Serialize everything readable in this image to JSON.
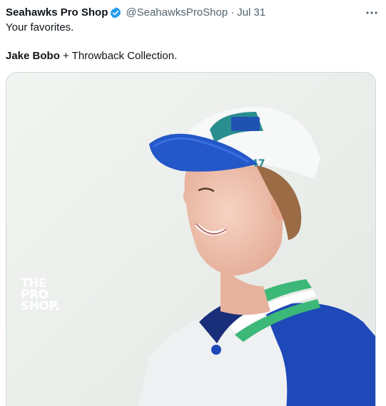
{
  "tweet": {
    "display_name": "Seahawks Pro Shop",
    "handle": "@SeahawksProShop",
    "separator": "·",
    "date": "Jul 31",
    "line1": "Your favorites.",
    "line2_bold": "Jake Bobo",
    "line2_rest": " + Throwback Collection."
  },
  "media": {
    "watermark_lines": [
      "THE",
      "PRO",
      "SHOP."
    ],
    "hat_logo_text": "47"
  },
  "icons": {
    "verified": "verified-badge-icon",
    "more": "more-options-icon"
  },
  "colors": {
    "verified_blue": "#1d9bf0",
    "muted_text": "#536471",
    "royal_blue": "#1f48b8",
    "action_green": "#3cb878"
  }
}
